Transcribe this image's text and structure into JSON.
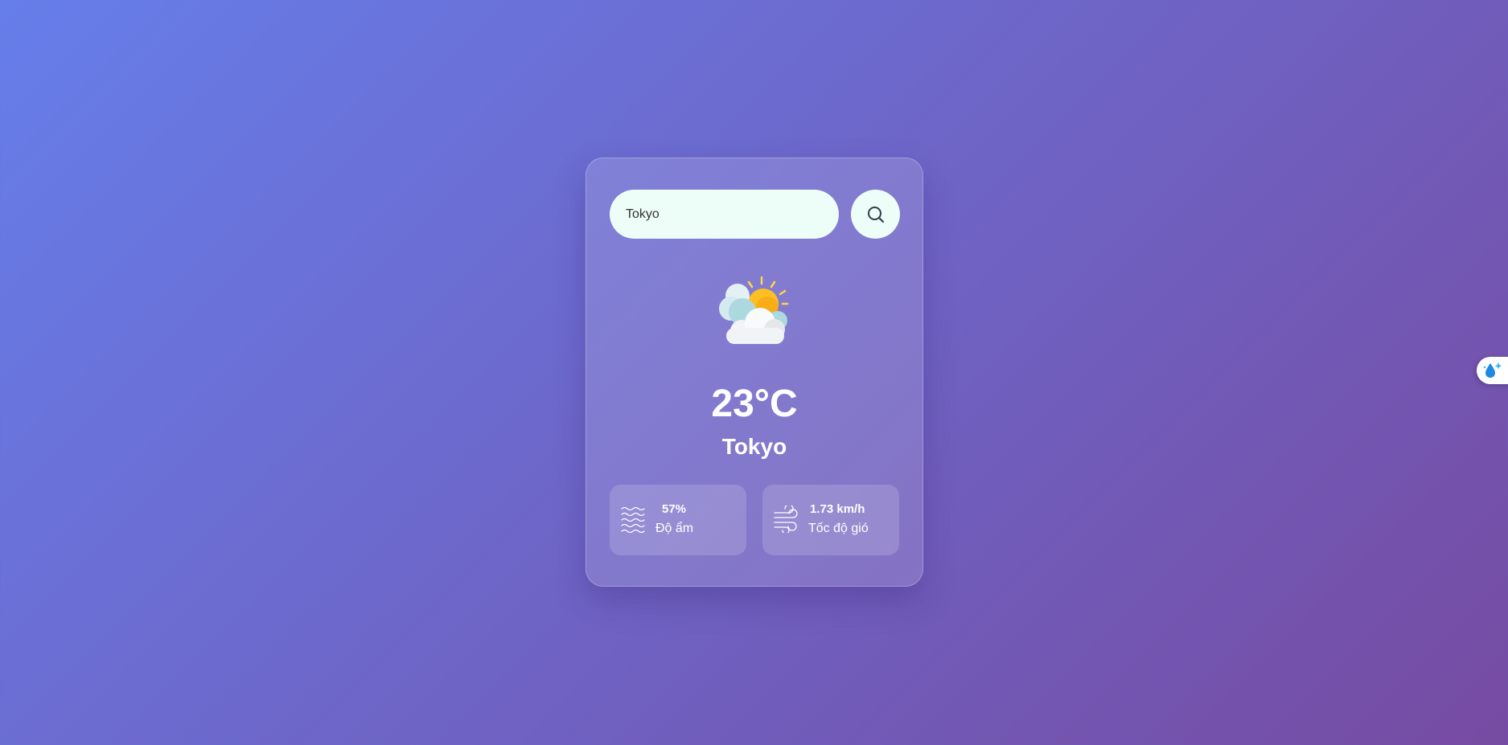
{
  "search": {
    "value": "Tokyo",
    "placeholder": ""
  },
  "icons": {
    "search_button": "search-icon",
    "weather": "partly-cloudy-icon",
    "humidity": "waves-icon",
    "wind": "wind-icon",
    "side_widget": "water-drop-sparkle-icon"
  },
  "weather": {
    "temperature": "23°C",
    "city": "Tokyo"
  },
  "details": {
    "humidity": {
      "value": "57%",
      "label": "Độ ẩm"
    },
    "wind": {
      "value": "1.73 km/h",
      "label": "Tốc độ gió"
    }
  },
  "colors": {
    "background_start": "#667eea",
    "background_end": "#764ba2",
    "input_background": "#edfdf8",
    "text": "#ffffff"
  }
}
